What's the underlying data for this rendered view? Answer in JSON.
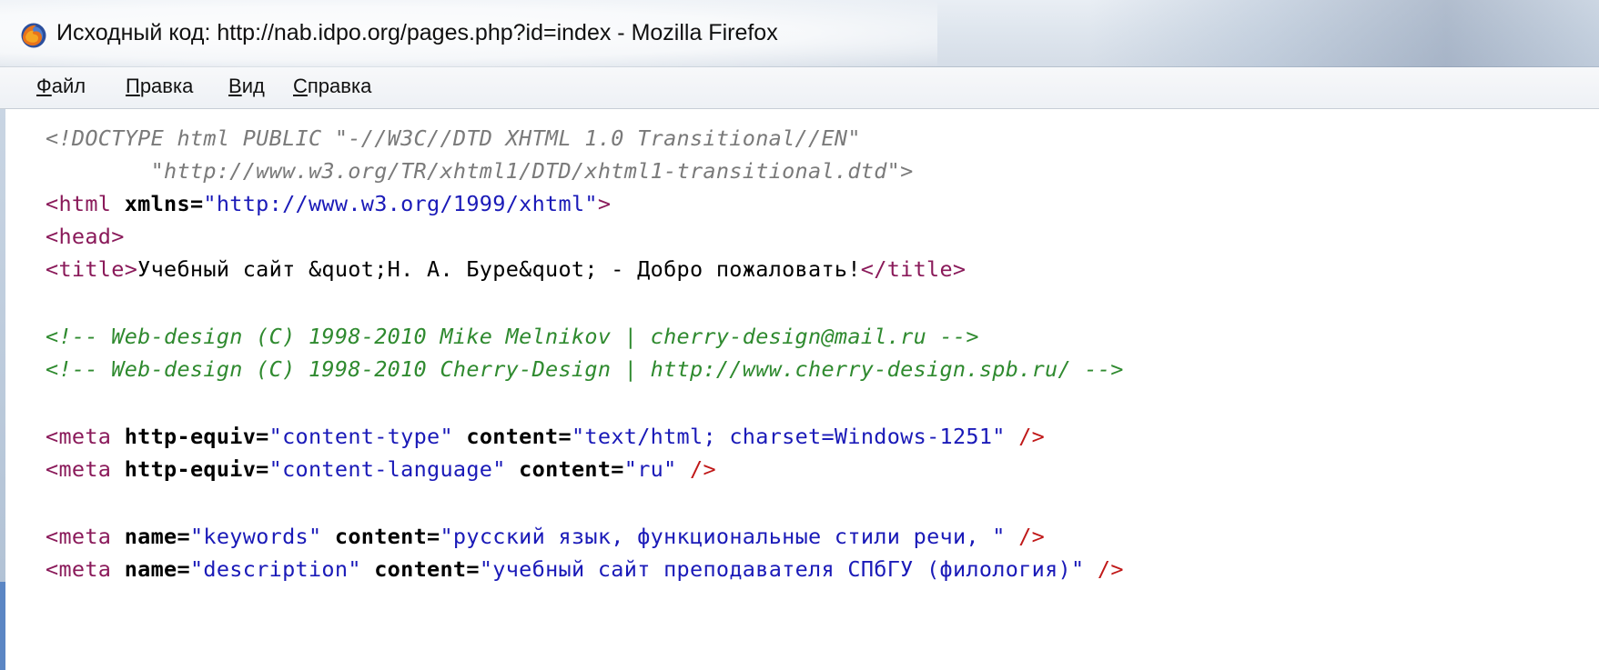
{
  "window": {
    "title": "Исходный код: http://nab.idpo.org/pages.php?id=index - Mozilla Firefox",
    "icon": "firefox-icon"
  },
  "menu": {
    "items": [
      {
        "accel": "Ф",
        "rest": "айл"
      },
      {
        "accel": "П",
        "rest": "равка"
      },
      {
        "accel": "В",
        "rest": "ид"
      },
      {
        "accel": "С",
        "rest": "правка"
      }
    ]
  },
  "source": {
    "doctype_1": "<!DOCTYPE html PUBLIC \"-//W3C//DTD XHTML 1.0 Transitional//EN\"",
    "doctype_2": "        \"http://www.w3.org/TR/xhtml1/DTD/xhtml1-transitional.dtd\">",
    "html_open": "<html",
    "html_attr": " xmlns=",
    "html_val": "\"http://www.w3.org/1999/xhtml\"",
    "html_close": ">",
    "head_tag": "<head>",
    "title_open": "<title>",
    "title_text": "Учебный сайт &quot;Н. А. Буре&quot; - Добро пожаловать!",
    "title_close": "</title>",
    "comment_1": "<!-- Web-design (C) 1998-2010 Mike Melnikov | cherry-design@mail.ru -->",
    "comment_2": "<!-- Web-design (C) 1998-2010 Cherry-Design | http://www.cherry-design.spb.ru/ -->",
    "meta_open": "<meta",
    "meta_http_equiv": " http-equiv=",
    "meta_name": " name=",
    "meta_content": " content=",
    "ct_equiv_val": "\"content-type\"",
    "ct_content_val": "\"text/html; charset=Windows-1251\"",
    "cl_equiv_val": "\"content-language\"",
    "cl_content_val": "\"ru\"",
    "kw_name_val": "\"keywords\"",
    "kw_content_val": "\"русский язык, функциональные стили речи, \"",
    "desc_name_val": "\"description\"",
    "desc_content_val": "\"учебный сайт преподавателя СПбГУ (филология)\"",
    "self_close": " />"
  },
  "colors": {
    "tag": "#8a1a5a",
    "attribute": "#000000",
    "value": "#1a1ab8",
    "comment": "#2f8a2f",
    "doctype": "#7a7a7a",
    "self_close": "#c01818"
  }
}
